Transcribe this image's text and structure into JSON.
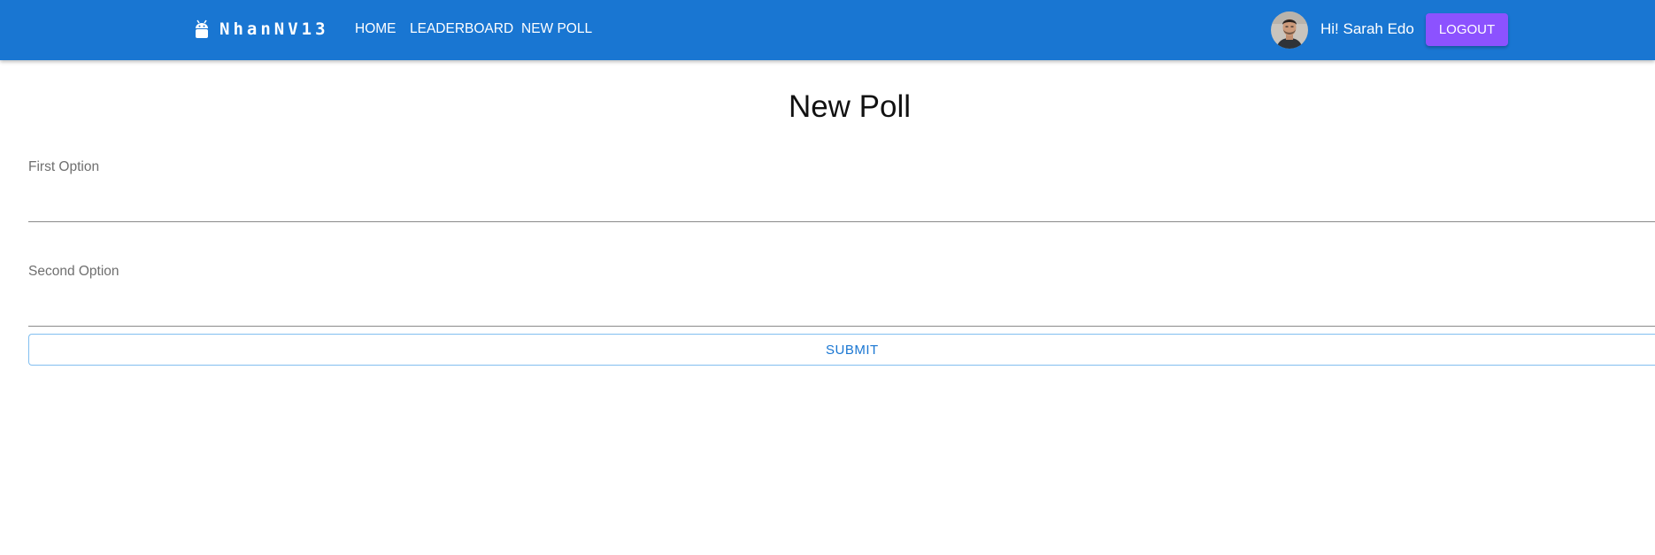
{
  "header": {
    "brand": "NhanNV13",
    "brand_icon": "android-icon",
    "nav": {
      "home": "HOME",
      "leaderboard": "LEADERBOARD",
      "new_poll": "NEW POLL"
    },
    "greeting": "Hi! Sarah Edo",
    "logout": "LOGOUT"
  },
  "main": {
    "title": "New Poll",
    "first_option_label": "First Option",
    "first_option_value": "",
    "second_option_label": "Second Option",
    "second_option_value": "",
    "submit": "SUBMIT"
  },
  "colors": {
    "appbar": "#1976d2",
    "logout_button": "#8c52ff",
    "submit_text": "#1976d2"
  }
}
